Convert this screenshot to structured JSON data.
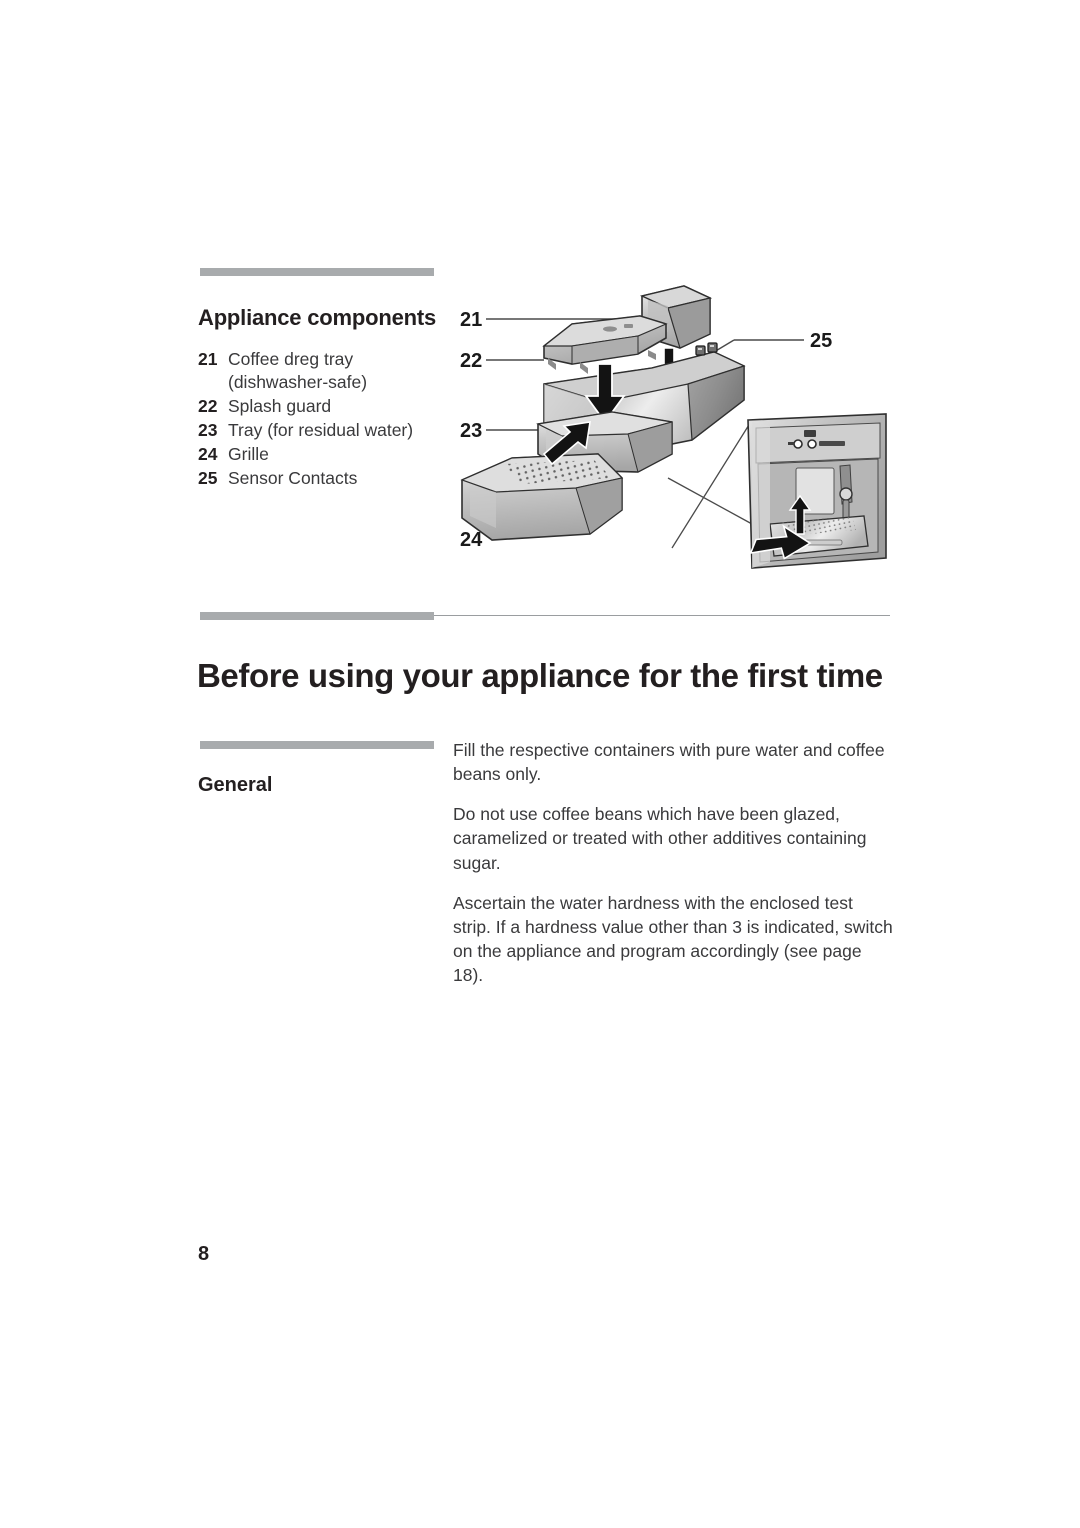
{
  "page": {
    "number": "8"
  },
  "components_section": {
    "heading": "Appliance components",
    "items": [
      {
        "number": "21",
        "label": "Coffee dreg tray",
        "sub": "(dishwasher-safe)"
      },
      {
        "number": "22",
        "label": "Splash guard",
        "sub": ""
      },
      {
        "number": "23",
        "label": "Tray (for residual water)",
        "sub": ""
      },
      {
        "number": "24",
        "label": "Grille",
        "sub": ""
      },
      {
        "number": "25",
        "label": "Sensor Contacts",
        "sub": ""
      }
    ],
    "illustration": {
      "name": "exploded-view-of-drip-tray-assembly",
      "callouts": [
        "21",
        "22",
        "23",
        "24",
        "25"
      ],
      "parts": [
        "coffee-dreg-tray",
        "splash-guard",
        "residual-water-tray",
        "grille",
        "sensor-contacts",
        "built-in-appliance-inset"
      ]
    }
  },
  "before_section": {
    "heading": "Before using your appliance for the first time",
    "subheading": "General",
    "paragraphs": [
      "Fill the respective containers with pure water and coffee beans only.",
      "Do not use coffee beans which have been glazed, caramelized or treated with other additives containing sugar.",
      "Ascertain the water hardness with the enclosed test strip. If a hardness value other than 3 is indicated, switch on the appliance and program accordingly (see page 18)."
    ]
  },
  "colors": {
    "rule_gray": "#a8abad",
    "thin_rule_gray": "#9a9da0",
    "heading_black": "#231f20",
    "body_gray": "#3a3a3c"
  }
}
